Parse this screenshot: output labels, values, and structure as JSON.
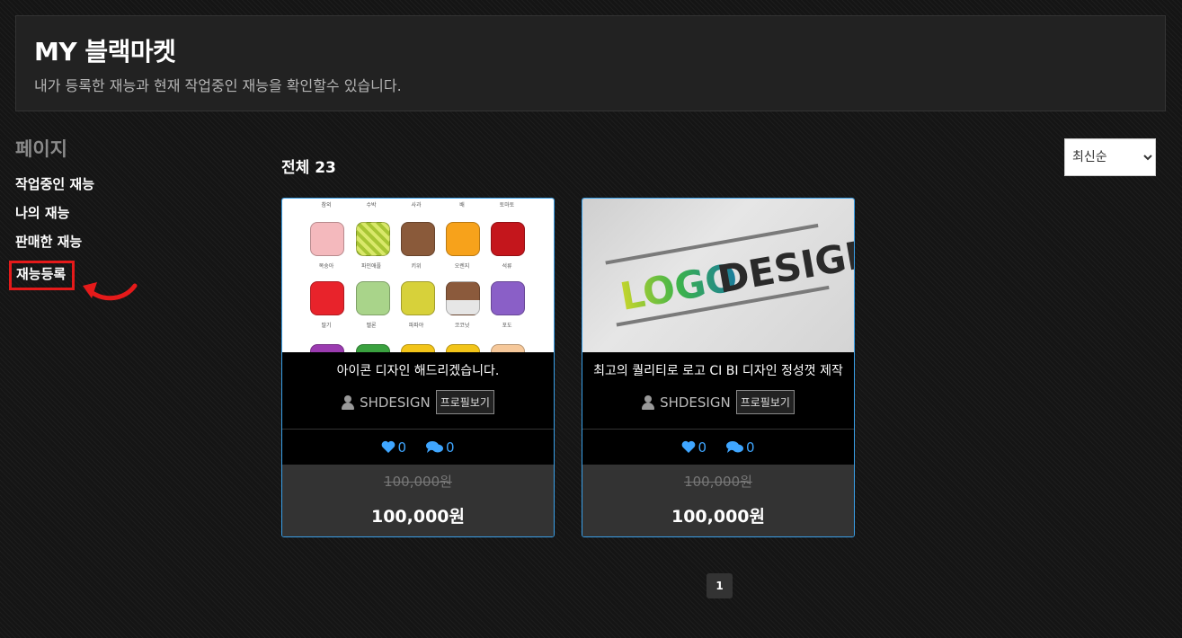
{
  "header": {
    "title": "MY 블랙마켓",
    "subtitle": "내가 등록한 재능과 현재 작업중인 재능을 확인할수 있습니다."
  },
  "sidebar": {
    "heading": "페이지",
    "items": [
      {
        "label": "작업중인 재능"
      },
      {
        "label": "나의 재능"
      },
      {
        "label": "판매한 재능"
      },
      {
        "label": "재능등록"
      }
    ]
  },
  "list": {
    "total_label": "전체 23",
    "sort_selected": "최신순"
  },
  "cards": [
    {
      "title": "아이콘 디자인 해드리겠습니다.",
      "seller": "SHDESIGN",
      "profile_button": "프로필보기",
      "likes": "0",
      "comments": "0",
      "old_price": "100,000원",
      "price": "100,000원",
      "thumb_labels_row1": [
        "참외",
        "수박",
        "사과",
        "배",
        "토마토"
      ],
      "thumb_labels_row2": [
        "복숭아",
        "파인애플",
        "키위",
        "오렌지",
        "석류"
      ],
      "thumb_labels_row3": [
        "딸기",
        "멜론",
        "파파야",
        "코코넛",
        "포도"
      ]
    },
    {
      "title": "최고의 퀄리티로 로고 CI BI 디자인 정성껏 제작",
      "seller": "SHDESIGN",
      "profile_button": "프로필보기",
      "likes": "0",
      "comments": "0",
      "old_price": "100,000원",
      "price": "100,000원",
      "thumb_logo_text_1": "LOGO",
      "thumb_logo_text_2": "DESIGN"
    }
  ],
  "pagination": {
    "current": "1"
  },
  "colors": {
    "accent": "#3aa0e8",
    "highlight": "#e51a1a",
    "icon_blue": "#3fa6ff"
  }
}
